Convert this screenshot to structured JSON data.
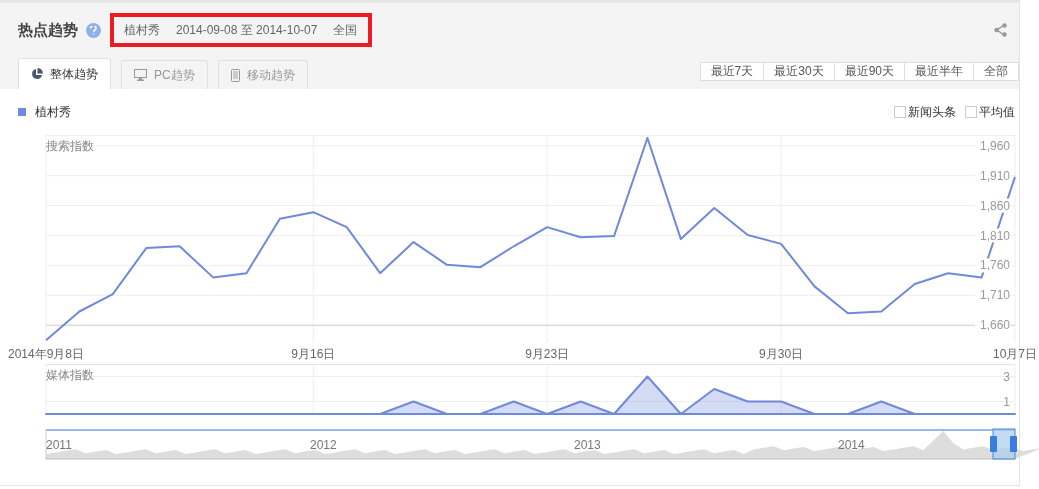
{
  "header": {
    "title": "热点趋势",
    "keyword": "植村秀",
    "date_range": "2014-09-08 至 2014-10-07",
    "region": "全国"
  },
  "tabs": [
    {
      "label": "整体趋势",
      "selected": true,
      "kind": "pie"
    },
    {
      "label": "PC趋势",
      "selected": false,
      "kind": "desktop"
    },
    {
      "label": "移动趋势",
      "selected": false,
      "kind": "mobile"
    }
  ],
  "ranges": [
    "最近7天",
    "最近30天",
    "最近90天",
    "最近半年",
    "全部"
  ],
  "options": [
    {
      "label": "新闻头条",
      "checked": false
    },
    {
      "label": "平均值",
      "checked": false
    }
  ],
  "search_chart": {
    "label": "搜索指数",
    "chart_data": {
      "type": "line",
      "grid": true,
      "categories": [
        "2014年9月8日",
        null,
        null,
        null,
        null,
        null,
        null,
        null,
        "9月16日",
        null,
        null,
        null,
        null,
        null,
        null,
        "9月23日",
        null,
        null,
        null,
        null,
        null,
        null,
        "9月30日",
        null,
        null,
        null,
        null,
        null,
        null,
        "10月7日"
      ],
      "ylim": [
        1632,
        1978
      ],
      "yticks": [
        {
          "value": 1660,
          "label": "1,660"
        },
        {
          "value": 1710,
          "label": "1,710"
        },
        {
          "value": 1760,
          "label": "1,760"
        },
        {
          "value": 1810,
          "label": "1,810"
        },
        {
          "value": 1860,
          "label": "1,860"
        },
        {
          "value": 1910,
          "label": "1,910"
        },
        {
          "value": 1960,
          "label": "1,960"
        }
      ],
      "series": [
        {
          "name": "植村秀",
          "color": "#7189d9",
          "values": [
            1635,
            1683,
            1712,
            1789,
            1792,
            1740,
            1747,
            1838,
            1849,
            1824,
            1747,
            1799,
            1761,
            1757,
            1792,
            1824,
            1807,
            1809,
            1973,
            1804,
            1856,
            1811,
            1796,
            1725,
            1680,
            1683,
            1729,
            1747,
            1740,
            1908
          ]
        }
      ]
    }
  },
  "media_chart": {
    "label": "媒体指数",
    "chart_data": {
      "type": "area",
      "grid": true,
      "ylim": [
        0,
        4
      ],
      "yticks": [
        {
          "value": 1,
          "label": "1"
        },
        {
          "value": 3,
          "label": "3"
        }
      ],
      "series": [
        {
          "color": "#7189d9",
          "values": [
            0,
            0,
            0,
            0,
            0,
            0,
            0,
            0,
            0,
            0,
            0,
            1,
            0,
            0,
            1,
            0,
            1,
            0,
            3,
            0,
            2,
            1,
            1,
            0,
            0,
            1,
            0,
            0,
            0,
            0
          ]
        }
      ]
    }
  },
  "navigator": {
    "years": [
      "2011",
      "2012",
      "2013",
      "2014"
    ]
  }
}
